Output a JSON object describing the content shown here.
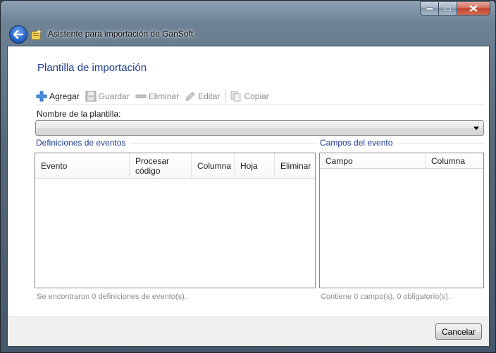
{
  "window": {
    "title": "Asistente para importación de GanSoft"
  },
  "page": {
    "title": "Plantilla de importación"
  },
  "toolbar": {
    "items": [
      {
        "label": "Agregar",
        "icon": "plus-icon",
        "enabled": true
      },
      {
        "label": "Guardar",
        "icon": "floppy-disk-icon",
        "enabled": false
      },
      {
        "label": "Eliminar",
        "icon": "minus-icon",
        "enabled": false
      },
      {
        "label": "Editar",
        "icon": "pencil-icon",
        "enabled": false
      },
      {
        "label": "Copiar",
        "icon": "copy-icon",
        "enabled": false
      }
    ]
  },
  "template": {
    "label": "Nombre de la plantilla:",
    "value": ""
  },
  "events": {
    "title": "Definiciones de eventos",
    "columns": [
      "Evento",
      "Procesar código",
      "Columna",
      "Hoja",
      "Eliminar"
    ],
    "rows": [],
    "summary": "Se encontraron 0 definiciones de evento(s)."
  },
  "fields": {
    "title": "Campos del evento",
    "columns": [
      "Campo",
      "Columna"
    ],
    "rows": [],
    "summary": "Contiene 0 campo(s), 0 obligatorio(s)."
  },
  "footer": {
    "cancel_label": "Cancelar"
  },
  "colors": {
    "accent_text": "#1e3a8f",
    "close_button": "#c2432d"
  }
}
